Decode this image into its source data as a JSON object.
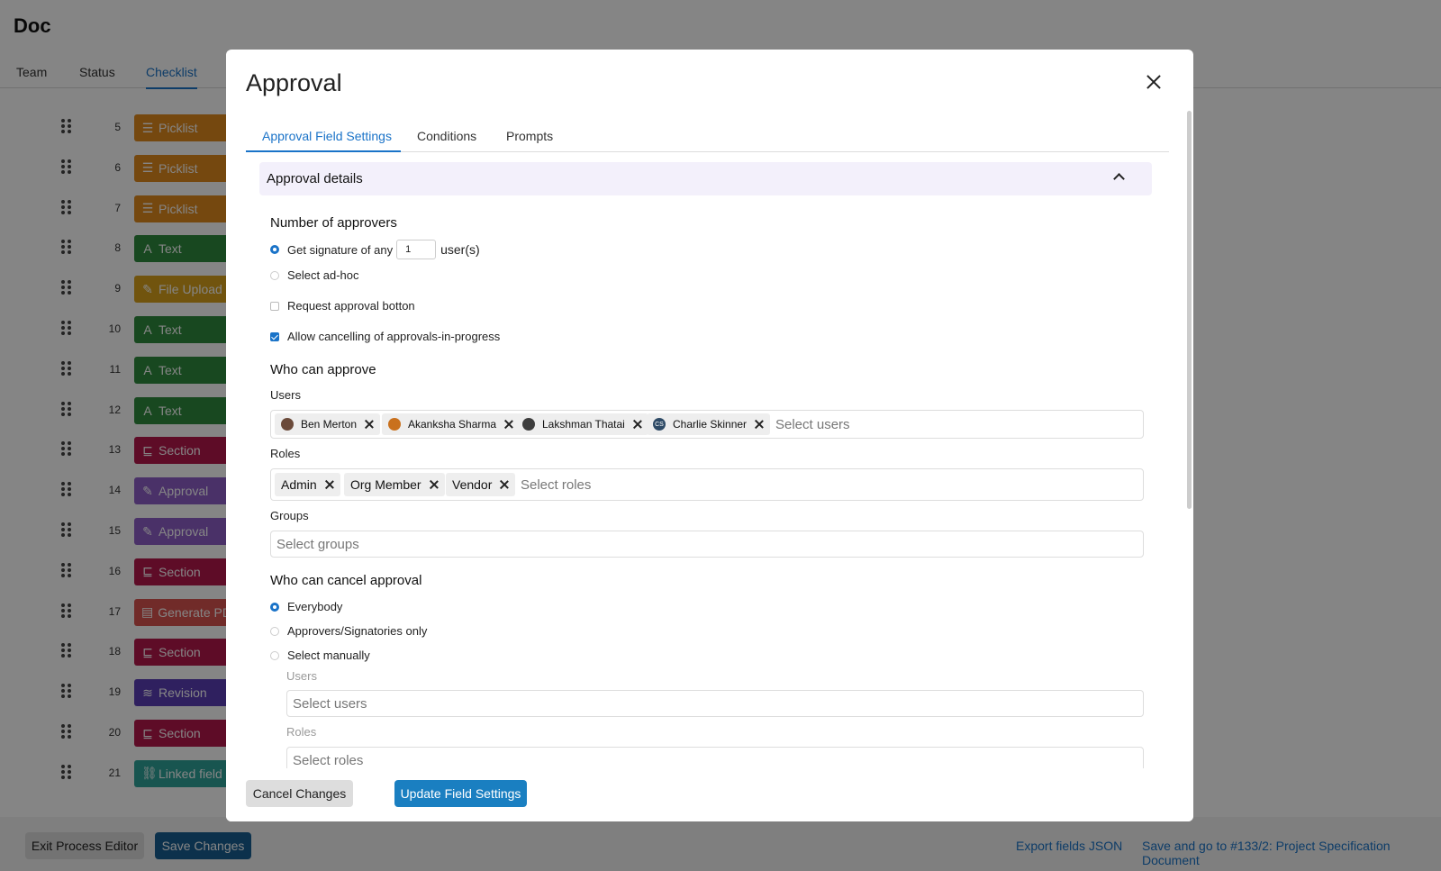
{
  "app": {
    "title": "Doc"
  },
  "background_tabs": [
    {
      "label": "Team",
      "active": false
    },
    {
      "label": "Status",
      "active": false
    },
    {
      "label": "Checklist",
      "active": true
    }
  ],
  "rows": [
    {
      "num": "5",
      "label": "Picklist",
      "icon": "list-icon",
      "glyph": "☰",
      "color": "#e08a1e"
    },
    {
      "num": "6",
      "label": "Picklist",
      "icon": "list-icon",
      "glyph": "☰",
      "color": "#e08a1e"
    },
    {
      "num": "7",
      "label": "Picklist",
      "icon": "list-icon",
      "glyph": "☰",
      "color": "#e08a1e"
    },
    {
      "num": "8",
      "label": "Text",
      "icon": "text-icon",
      "glyph": "A",
      "color": "#2e8b3e"
    },
    {
      "num": "9",
      "label": "File Upload",
      "icon": "pen-icon",
      "glyph": "✎",
      "color": "#d9a21b"
    },
    {
      "num": "10",
      "label": "Text",
      "icon": "text-icon",
      "glyph": "A",
      "color": "#2e8b3e"
    },
    {
      "num": "11",
      "label": "Text",
      "icon": "text-icon",
      "glyph": "A",
      "color": "#2e8b3e"
    },
    {
      "num": "12",
      "label": "Text",
      "icon": "text-icon",
      "glyph": "A",
      "color": "#2e8b3e"
    },
    {
      "num": "13",
      "label": "Section",
      "icon": "section-icon",
      "glyph": "⊑",
      "color": "#b5174c"
    },
    {
      "num": "14",
      "label": "Approval",
      "icon": "sign-icon",
      "glyph": "✎",
      "color": "#8e5ec8"
    },
    {
      "num": "15",
      "label": "Approval",
      "icon": "sign-icon",
      "glyph": "✎",
      "color": "#8e5ec8"
    },
    {
      "num": "16",
      "label": "Section",
      "icon": "section-icon",
      "glyph": "⊑",
      "color": "#b5174c"
    },
    {
      "num": "17",
      "label": "Generate PDF",
      "icon": "document-icon",
      "glyph": "▤",
      "color": "#d9534f"
    },
    {
      "num": "18",
      "label": "Section",
      "icon": "section-icon",
      "glyph": "⊑",
      "color": "#b5174c"
    },
    {
      "num": "19",
      "label": "Revision",
      "icon": "layers-icon",
      "glyph": "≋",
      "color": "#5b3fb6"
    },
    {
      "num": "20",
      "label": "Section",
      "icon": "section-icon",
      "glyph": "⊑",
      "color": "#b5174c"
    },
    {
      "num": "21",
      "label": "Linked field",
      "icon": "link-icon",
      "glyph": "⛓",
      "color": "#2fa39a"
    }
  ],
  "footer": {
    "exit_label": "Exit Process Editor",
    "save_label": "Save Changes",
    "export_label": "Export fields JSON",
    "save_go_label": "Save and go to #133/2: Project Specification Document"
  },
  "modal": {
    "title": "Approval",
    "tabs": [
      {
        "label": "Approval Field Settings",
        "active": true
      },
      {
        "label": "Conditions",
        "active": false
      },
      {
        "label": "Prompts",
        "active": false
      }
    ],
    "accordion_title": "Approval details",
    "num_approvers": {
      "heading": "Number of approvers",
      "opt_any_prefix": "Get signature of any",
      "opt_any_value": "1",
      "opt_any_suffix": "user(s)",
      "opt_adhoc": "Select ad-hoc",
      "request_button": "Request approval botton",
      "allow_cancel": "Allow cancelling of approvals-in-progress"
    },
    "who_approve": {
      "heading": "Who can approve",
      "users_label": "Users",
      "users": [
        {
          "name": "Ben Merton",
          "avatar_color": "#6b4a3a"
        },
        {
          "name": "Akanksha Sharma",
          "avatar_color": "#c9711e"
        },
        {
          "name": "Lakshman Thatai",
          "avatar_color": "#3d3d3d"
        },
        {
          "name": "Charlie Skinner",
          "avatar_color": "#2e4a66",
          "initials": "CS"
        }
      ],
      "users_placeholder": "Select users",
      "roles_label": "Roles",
      "roles": [
        "Admin",
        "Org Member",
        "Vendor"
      ],
      "roles_placeholder": "Select roles",
      "groups_label": "Groups",
      "groups_placeholder": "Select groups"
    },
    "who_cancel": {
      "heading": "Who can cancel approval",
      "opt_everybody": "Everybody",
      "opt_approvers": "Approvers/Signatories only",
      "opt_manual": "Select manually",
      "users_label": "Users",
      "users_placeholder": "Select users",
      "roles_label": "Roles",
      "roles_placeholder": "Select roles"
    },
    "cancel_label": "Cancel Changes",
    "update_label": "Update Field Settings"
  },
  "colors": {
    "accent": "#1a73c8",
    "primary_button": "#1a7fc1",
    "accordion_bg": "#f3f0fb"
  }
}
